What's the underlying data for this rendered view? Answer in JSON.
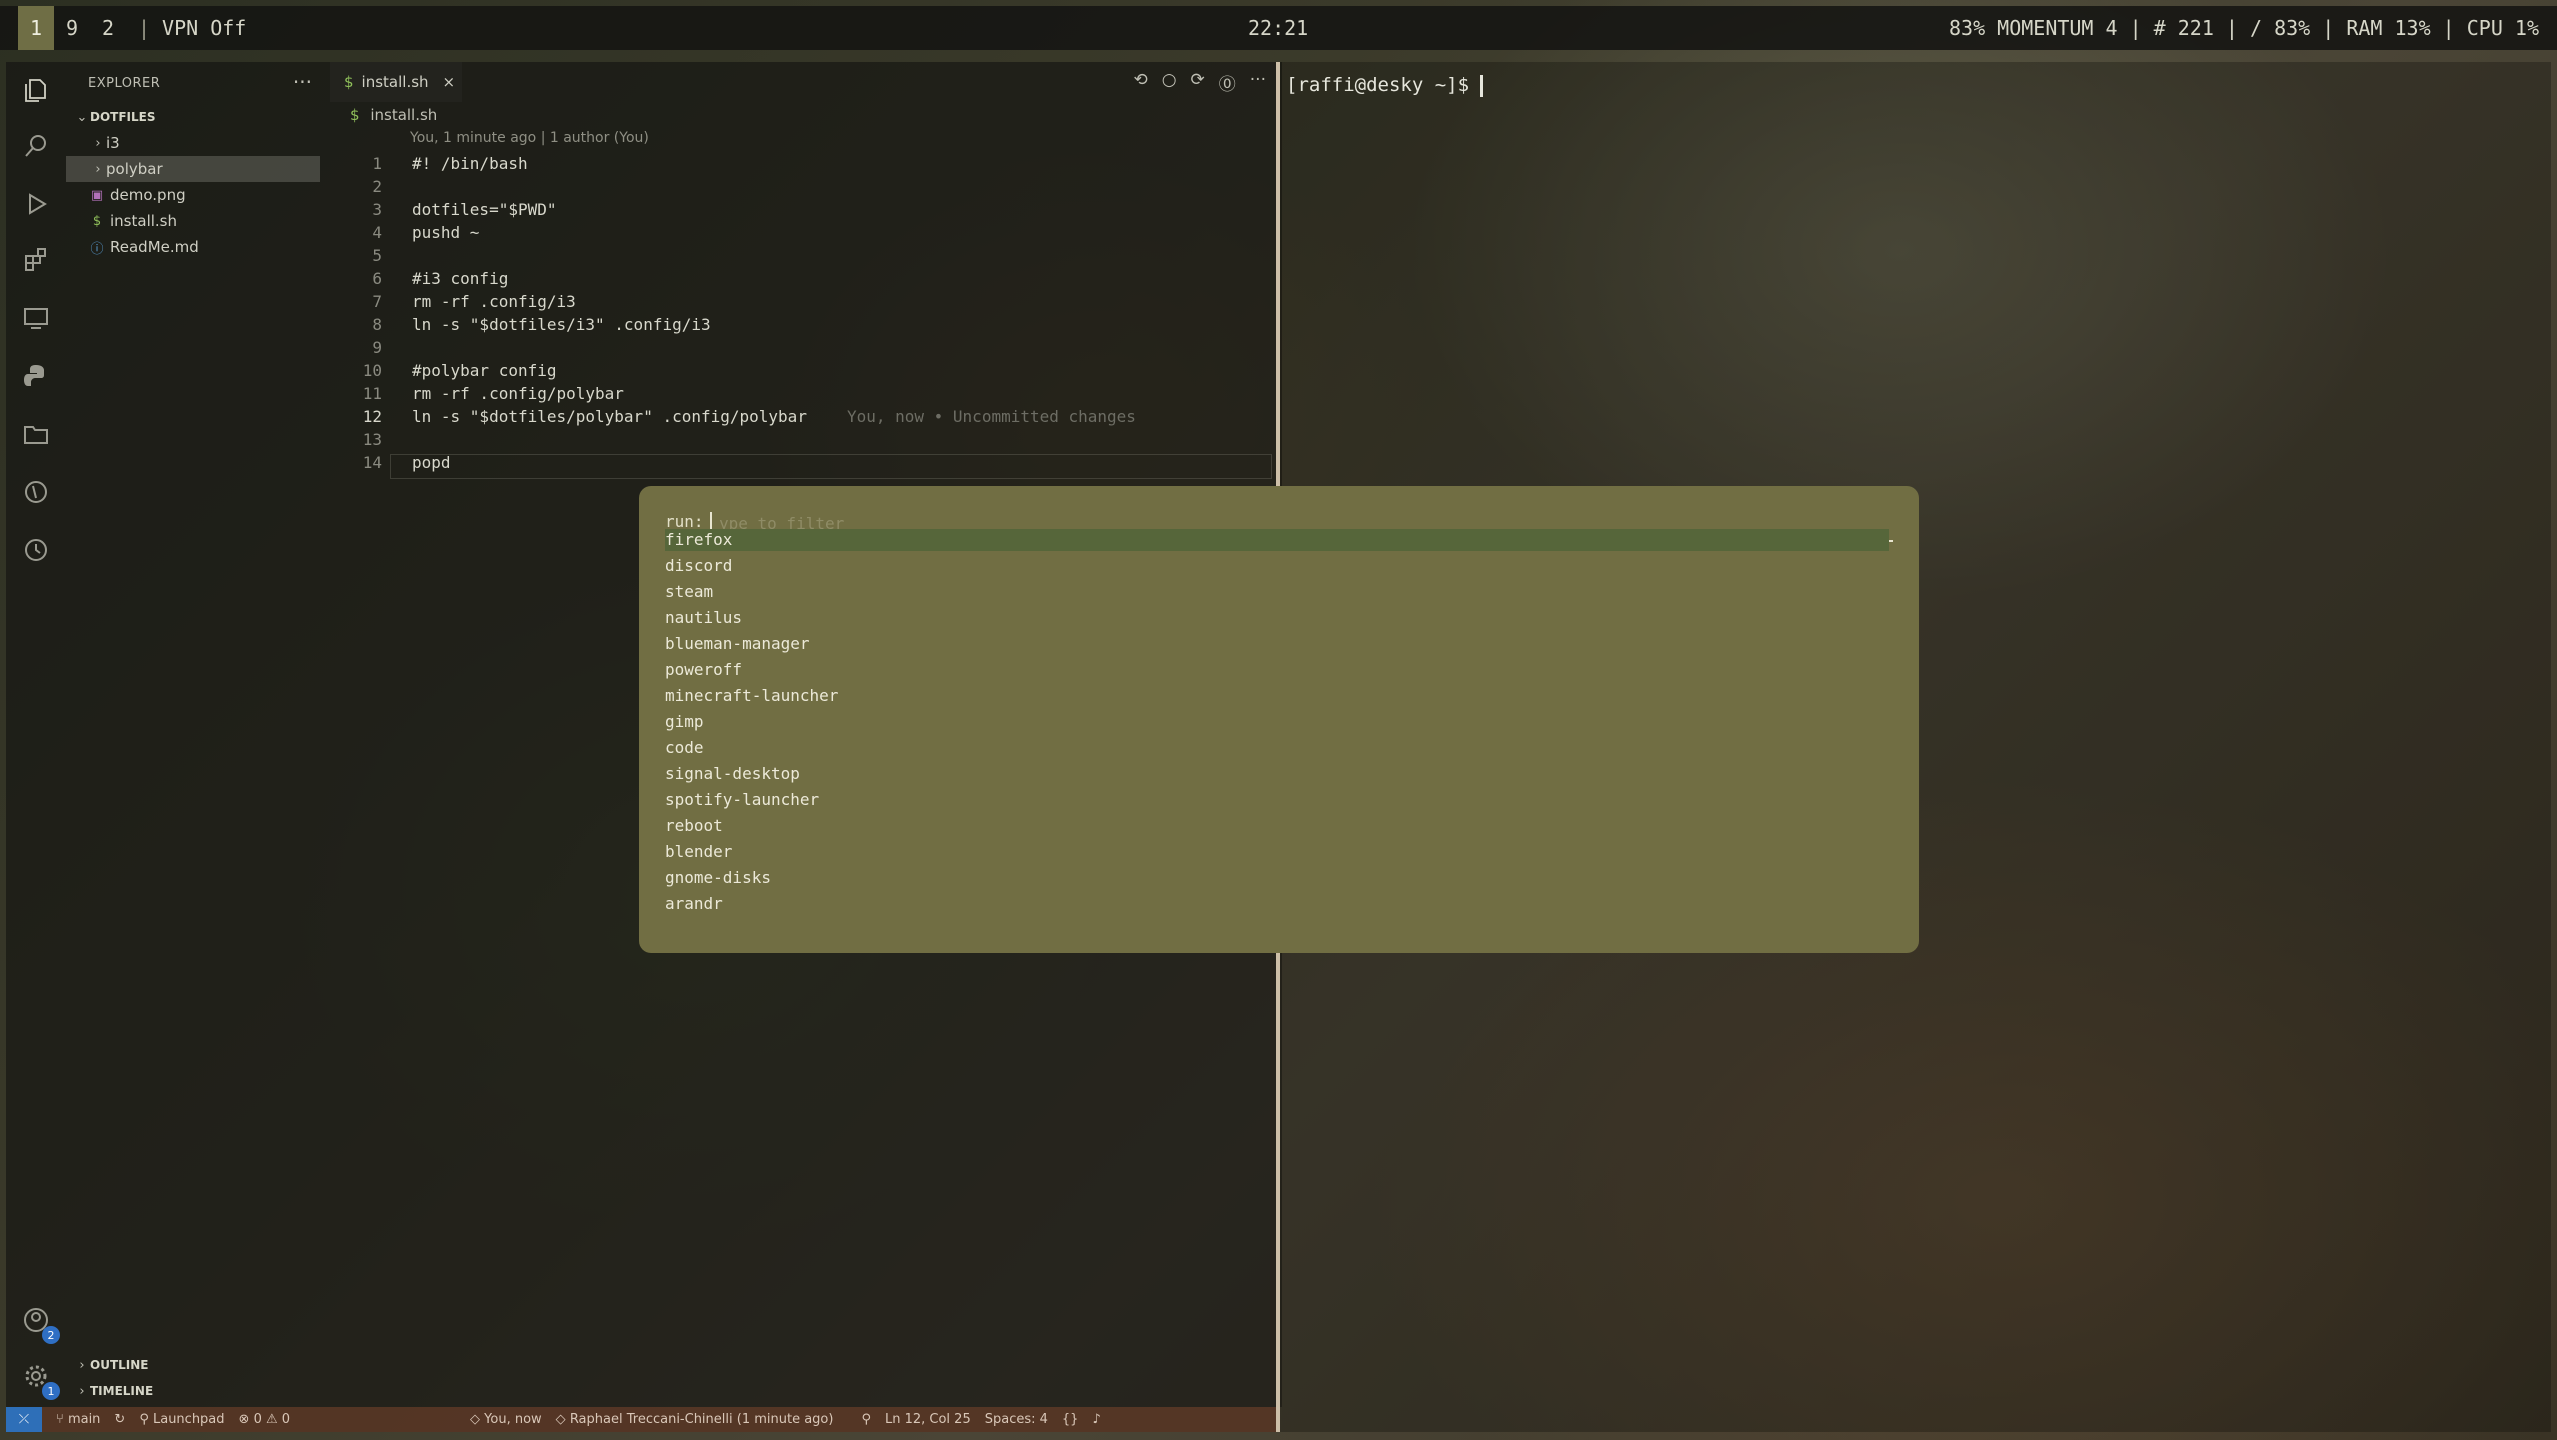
{
  "polybar": {
    "workspaces": [
      {
        "label": "1",
        "active": true
      },
      {
        "label": "9",
        "active": false
      },
      {
        "label": "2",
        "active": false
      }
    ],
    "vpn": "VPN Off",
    "clock": "22:21",
    "status": "83% MOMENTUM 4 | # 221 | / 83% | RAM 13% | CPU   1%"
  },
  "vscode": {
    "sidebar": {
      "title": "EXPLORER",
      "more": "···",
      "section": "DOTFILES",
      "items": [
        {
          "label": "i3"
        },
        {
          "label": "polybar"
        },
        {
          "label": "demo.png"
        },
        {
          "label": "install.sh"
        },
        {
          "label": "ReadMe.md"
        }
      ],
      "outline": "OUTLINE",
      "timeline": "TIMELINE"
    },
    "tab": {
      "label": "install.sh",
      "icon": "$",
      "close": "×"
    },
    "breadcrumb": "install.sh",
    "blame_header": "You, 1 minute ago | 1 author (You)",
    "lines": [
      {
        "n": "1",
        "code": "#! /bin/bash"
      },
      {
        "n": "2",
        "code": ""
      },
      {
        "n": "3",
        "code": "dotfiles=\"$PWD\""
      },
      {
        "n": "4",
        "code": "pushd ~"
      },
      {
        "n": "5",
        "code": ""
      },
      {
        "n": "6",
        "code": "#i3 config"
      },
      {
        "n": "7",
        "code": "rm -rf .config/i3"
      },
      {
        "n": "8",
        "code": "ln -s \"$dotfiles/i3\" .config/i3"
      },
      {
        "n": "9",
        "code": ""
      },
      {
        "n": "10",
        "code": "#polybar config"
      },
      {
        "n": "11",
        "code": "rm -rf .config/polybar"
      },
      {
        "n": "12",
        "code": "ln -s \"$dotfiles/polybar\" .config/polybar"
      },
      {
        "n": "13",
        "code": ""
      },
      {
        "n": "14",
        "code": "popd"
      }
    ],
    "inline_blame": "You, now • Uncommitted changes",
    "status": {
      "branch": "main",
      "launchpad": "Launchpad",
      "problems": "0 ⚠ 0",
      "blame": "You, now",
      "author": "Raphael Treccani-Chinelli (1 minute ago)",
      "position": "Ln 12, Col 25",
      "spaces": "Spaces: 4",
      "notifications_badge": "1",
      "accounts_badge": "2"
    }
  },
  "terminal": {
    "prompt": "[raffi@desky ~]$ "
  },
  "launcher": {
    "label": "run:",
    "placeholder": "ype to filter",
    "items": [
      "firefox",
      "discord",
      "steam",
      "nautilus",
      "blueman-manager",
      "poweroff",
      "minecraft-launcher",
      "gimp",
      "code",
      "signal-desktop",
      "spotify-launcher",
      "reboot",
      "blender",
      "gnome-disks",
      "arandr"
    ],
    "selected": 0
  },
  "colors": {
    "launcher_bg": "#716e43",
    "launcher_selected": "#56663a",
    "workspace_active": "#6f6e45",
    "remote_button": "#2e6fb8"
  }
}
